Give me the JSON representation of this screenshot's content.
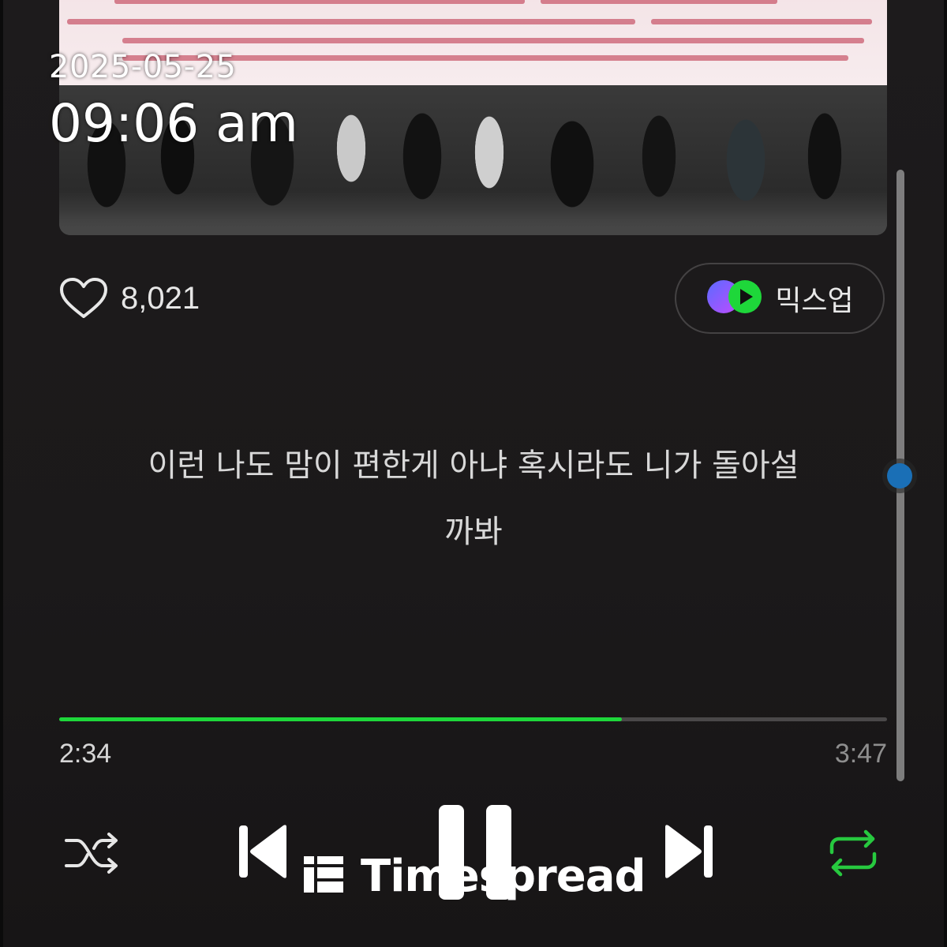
{
  "overlay": {
    "date": "2025-05-25",
    "time": "09:06 am"
  },
  "album": {
    "image": "concert-crowd-with-banner"
  },
  "like": {
    "count": "8,021",
    "icon": "heart-outline-icon"
  },
  "mixup": {
    "label": "믹스업",
    "icon": "mixup-logo-icon"
  },
  "lyric": {
    "line1": "이런 나도 맘이 편한게 아냐 혹시라도 니가 돌아설",
    "line2": "까봐"
  },
  "playback": {
    "elapsed": "2:34",
    "total": "3:47",
    "progress_fraction": 0.68
  },
  "controls": {
    "shuffle_icon": "shuffle-icon",
    "prev_icon": "skip-previous-icon",
    "pause_icon": "pause-icon",
    "next_icon": "skip-next-icon",
    "repeat_icon": "repeat-icon"
  },
  "watermark": {
    "text": "Timespread"
  },
  "colors": {
    "accent": "#1ed73a",
    "repeat_active": "#27c93f",
    "scroll_thumb": "#1a6fb6"
  }
}
